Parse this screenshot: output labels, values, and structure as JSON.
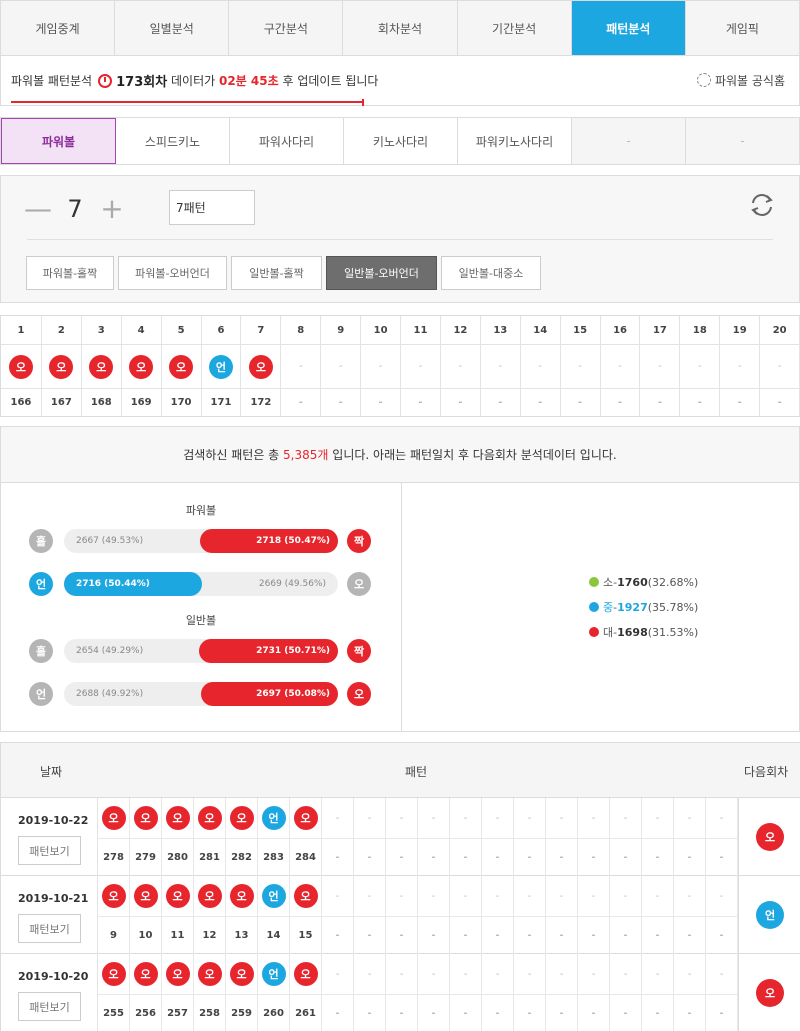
{
  "top_tabs": [
    "게임중계",
    "일별분석",
    "구간분석",
    "회차분석",
    "기간분석",
    "패턴분석",
    "게임픽"
  ],
  "top_tabs_active": 5,
  "info": {
    "prefix": "파워볼 패턴분석",
    "round": "173회차",
    "mid": "데이터가",
    "time": "02분 45초",
    "suffix": "후 업데이트 됩니다",
    "site": "파워볼 공식홈"
  },
  "game_tabs": [
    "파워볼",
    "스피드키노",
    "파워사다리",
    "키노사다리",
    "파워키노사다리",
    "-",
    "-"
  ],
  "game_tabs_active": 0,
  "stepper": {
    "minus": "—",
    "value": "7",
    "plus": "+"
  },
  "pattern_input": "7패턴",
  "options": [
    "파워볼-홀짝",
    "파워볼-오버언더",
    "일반볼-홀짝",
    "일반볼-오버언더",
    "일반볼-대중소"
  ],
  "options_active": 3,
  "grid": {
    "headers": [
      "1",
      "2",
      "3",
      "4",
      "5",
      "6",
      "7",
      "8",
      "9",
      "10",
      "11",
      "12",
      "13",
      "14",
      "15",
      "16",
      "17",
      "18",
      "19",
      "20"
    ],
    "balls": [
      "오",
      "오",
      "오",
      "오",
      "오",
      "언",
      "오",
      "-",
      "-",
      "-",
      "-",
      "-",
      "-",
      "-",
      "-",
      "-",
      "-",
      "-",
      "-",
      "-"
    ],
    "rounds": [
      "166",
      "167",
      "168",
      "169",
      "170",
      "171",
      "172",
      "-",
      "-",
      "-",
      "-",
      "-",
      "-",
      "-",
      "-",
      "-",
      "-",
      "-",
      "-",
      "-"
    ]
  },
  "summary": {
    "pre": "검색하신 패턴은 총",
    "count": "5,385개",
    "post": "입니다. 아래는 패턴일치 후 다음회차 분석데이터 입니다."
  },
  "stats": {
    "powerball_title": "파워볼",
    "normal_title": "일반볼",
    "bars": [
      {
        "left_label": "홀",
        "left_text": "2667 (49.53%)",
        "right_text": "2718 (50.47%)",
        "right_label": "짝",
        "left_pct": 49.53,
        "winner": "right",
        "win_color": "#e7252c",
        "right_ball": "red"
      },
      {
        "left_label": "언",
        "left_text": "2716 (50.44%)",
        "right_text": "2669 (49.56%)",
        "right_label": "오",
        "left_pct": 50.44,
        "winner": "left",
        "win_color": "#1da7e1",
        "left_ball": "blue"
      },
      {
        "left_label": "홀",
        "left_text": "2654 (49.29%)",
        "right_text": "2731 (50.71%)",
        "right_label": "짝",
        "left_pct": 49.29,
        "winner": "right",
        "win_color": "#e7252c",
        "right_ball": "red"
      },
      {
        "left_label": "언",
        "left_text": "2688 (49.92%)",
        "right_text": "2697 (50.08%)",
        "right_label": "오",
        "left_pct": 49.92,
        "winner": "right",
        "win_color": "#e7252c",
        "right_ball": "red"
      }
    ],
    "legend": [
      {
        "label": "소",
        "value": "1760",
        "pct": "(32.68%)",
        "color": "#8cc63f"
      },
      {
        "label": "중",
        "value": "1927",
        "pct": "(35.78%)",
        "color": "#1da7e1"
      },
      {
        "label": "대",
        "value": "1698",
        "pct": "(31.53%)",
        "color": "#e7252c"
      }
    ]
  },
  "history": {
    "head_date": "날짜",
    "head_pattern": "패턴",
    "head_next": "다음회차",
    "button_label": "패턴보기",
    "rows": [
      {
        "date": "2019-10-22",
        "balls": [
          "오",
          "오",
          "오",
          "오",
          "오",
          "언",
          "오"
        ],
        "rounds": [
          "278",
          "279",
          "280",
          "281",
          "282",
          "283",
          "284"
        ],
        "next": "오"
      },
      {
        "date": "2019-10-21",
        "balls": [
          "오",
          "오",
          "오",
          "오",
          "오",
          "언",
          "오"
        ],
        "rounds": [
          "9",
          "10",
          "11",
          "12",
          "13",
          "14",
          "15"
        ],
        "next": "언"
      },
      {
        "date": "2019-10-20",
        "balls": [
          "오",
          "오",
          "오",
          "오",
          "오",
          "언",
          "오"
        ],
        "rounds": [
          "255",
          "256",
          "257",
          "258",
          "259",
          "260",
          "261"
        ],
        "next": "오"
      }
    ]
  }
}
